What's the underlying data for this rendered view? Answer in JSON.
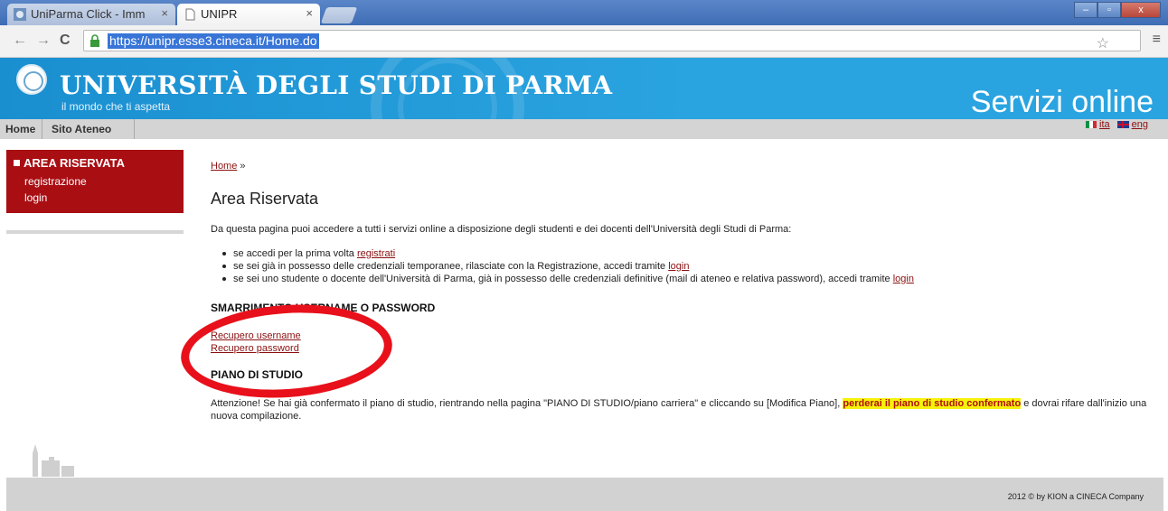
{
  "browser": {
    "tabs": [
      {
        "title": "UniParma Click - Imm",
        "active": false
      },
      {
        "title": "UNIPR",
        "active": true
      }
    ],
    "url": "https://unipr.esse3.cineca.it/Home.do",
    "window_buttons": {
      "minimize": "–",
      "maximize": "▫",
      "close": "x"
    }
  },
  "header": {
    "university_name": "UNIVERSITÀ DEGLI STUDI DI PARMA",
    "tagline": "il mondo che ti aspetta",
    "services_title": "Servizi online",
    "accent_color": "#2aa4e0"
  },
  "navbar": {
    "items": [
      "Home",
      "Sito Ateneo"
    ],
    "languages": [
      {
        "code": "ita",
        "flag": "flag-italy-icon"
      },
      {
        "code": "eng",
        "flag": "flag-uk-icon"
      }
    ]
  },
  "sidebar": {
    "title": "AREA RISERVATA",
    "items": [
      "registrazione",
      "login"
    ],
    "color": "#a90e13"
  },
  "main": {
    "breadcrumb": {
      "home": "Home",
      "sep": "»"
    },
    "title": "Area Riservata",
    "intro": "Da questa pagina puoi accedere a tutti i servizi online a disposizione degli studenti e dei docenti dell'Università degli Studi di Parma:",
    "bullets": [
      {
        "text": "se accedi per la prima volta",
        "link": "registrati"
      },
      {
        "text": "se sei già in possesso delle credenziali temporanee, rilasciate con la Registrazione, accedi tramite",
        "link": "login"
      },
      {
        "text": "se sei uno studente o docente dell'Università di Parma, già in possesso delle credenziali definitive (mail di ateneo e relativa password), accedi tramite",
        "link": "login"
      }
    ],
    "lost_credentials_heading": "SMARRIMENTO USERNAME O PASSWORD",
    "recover_username": "Recupero username",
    "recover_password": "Recupero password",
    "study_plan_heading": "PIANO DI STUDIO",
    "warning_part1": "Attenzione! Se hai già confermato il piano di studio, rientrando nella pagina \"PIANO DI STUDIO/piano carriera\" e cliccando su [Modifica Piano],",
    "warning_highlight": "perderai il piano di studio confermato",
    "warning_part2": "e dovrai rifare dall'inizio una nuova compilazione."
  },
  "footer": {
    "copyright": "2012 © by KION a CINECA Company"
  }
}
